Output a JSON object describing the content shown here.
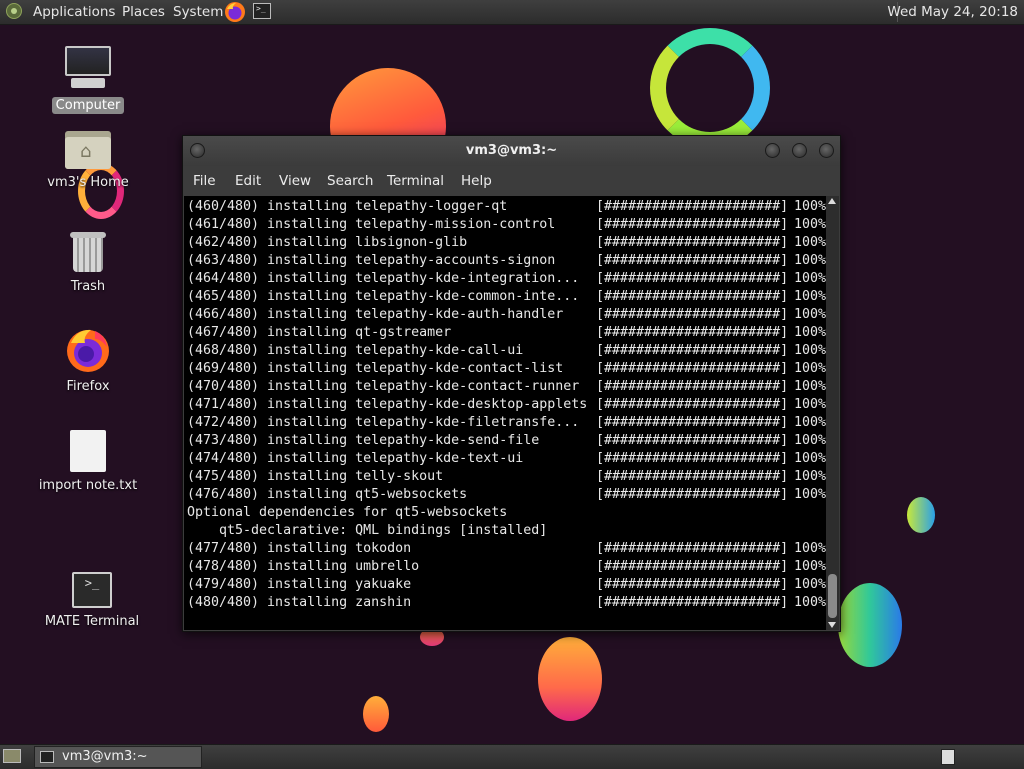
{
  "top_panel": {
    "menus": [
      "Applications",
      "Places",
      "System"
    ],
    "clock": "Wed May 24, 20:18",
    "launchers": [
      "firefox-icon",
      "terminal-icon"
    ]
  },
  "desktop": {
    "icons": [
      {
        "label": "Computer",
        "icon": "computer-icon"
      },
      {
        "label": "vm3's Home",
        "icon": "home-folder-icon"
      },
      {
        "label": "Trash",
        "icon": "trash-icon"
      },
      {
        "label": "Firefox",
        "icon": "firefox-icon"
      },
      {
        "label": "import note.txt",
        "icon": "text-file-icon"
      },
      {
        "label": "MATE Terminal",
        "icon": "terminal-icon"
      }
    ]
  },
  "terminal": {
    "title": "vm3@vm3:~",
    "menus": [
      "File",
      "Edit",
      "View",
      "Search",
      "Terminal",
      "Help"
    ],
    "lines": [
      {
        "text": "(460/480) installing telepathy-logger-qt",
        "bar": "[######################]",
        "pct": "100%"
      },
      {
        "text": "(461/480) installing telepathy-mission-control",
        "bar": "[######################]",
        "pct": "100%"
      },
      {
        "text": "(462/480) installing libsignon-glib",
        "bar": "[######################]",
        "pct": "100%"
      },
      {
        "text": "(463/480) installing telepathy-accounts-signon",
        "bar": "[######################]",
        "pct": "100%"
      },
      {
        "text": "(464/480) installing telepathy-kde-integration...",
        "bar": "[######################]",
        "pct": "100%"
      },
      {
        "text": "(465/480) installing telepathy-kde-common-inte...",
        "bar": "[######################]",
        "pct": "100%"
      },
      {
        "text": "(466/480) installing telepathy-kde-auth-handler",
        "bar": "[######################]",
        "pct": "100%"
      },
      {
        "text": "(467/480) installing qt-gstreamer",
        "bar": "[######################]",
        "pct": "100%"
      },
      {
        "text": "(468/480) installing telepathy-kde-call-ui",
        "bar": "[######################]",
        "pct": "100%"
      },
      {
        "text": "(469/480) installing telepathy-kde-contact-list",
        "bar": "[######################]",
        "pct": "100%"
      },
      {
        "text": "(470/480) installing telepathy-kde-contact-runner",
        "bar": "[######################]",
        "pct": "100%"
      },
      {
        "text": "(471/480) installing telepathy-kde-desktop-applets",
        "bar": "[######################]",
        "pct": "100%"
      },
      {
        "text": "(472/480) installing telepathy-kde-filetransfe...",
        "bar": "[######################]",
        "pct": "100%"
      },
      {
        "text": "(473/480) installing telepathy-kde-send-file",
        "bar": "[######################]",
        "pct": "100%"
      },
      {
        "text": "(474/480) installing telepathy-kde-text-ui",
        "bar": "[######################]",
        "pct": "100%"
      },
      {
        "text": "(475/480) installing telly-skout",
        "bar": "[######################]",
        "pct": "100%"
      },
      {
        "text": "(476/480) installing qt5-websockets",
        "bar": "[######################]",
        "pct": "100%"
      },
      {
        "text": "Optional dependencies for qt5-websockets",
        "bar": "",
        "pct": ""
      },
      {
        "text": "    qt5-declarative: QML bindings [installed]",
        "bar": "",
        "pct": ""
      },
      {
        "text": "(477/480) installing tokodon",
        "bar": "[######################]",
        "pct": "100%"
      },
      {
        "text": "(478/480) installing umbrello",
        "bar": "[######################]",
        "pct": "100%"
      },
      {
        "text": "(479/480) installing yakuake",
        "bar": "[######################]",
        "pct": "100%"
      },
      {
        "text": "(480/480) installing zanshin",
        "bar": "[######################]",
        "pct": "100%"
      }
    ]
  },
  "bottom_panel": {
    "task_label": "vm3@vm3:~"
  }
}
